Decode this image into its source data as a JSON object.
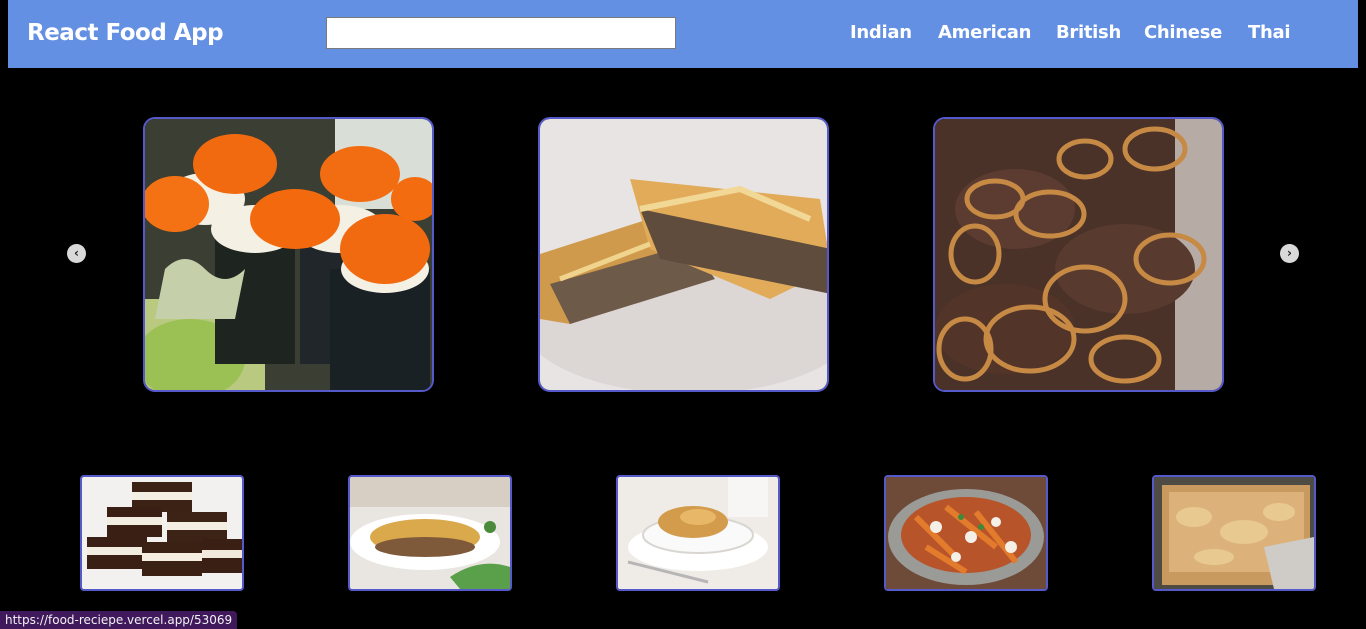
{
  "header": {
    "logo": "React Food App",
    "search": {
      "value": "",
      "placeholder": ""
    },
    "nav": [
      "Indian",
      "American",
      "British",
      "Chinese",
      "Thai"
    ]
  },
  "carousel": {
    "prev_icon": "chevron-left-icon",
    "next_icon": "chevron-right-icon",
    "slides": [
      {
        "image": "sushi-rolls-with-roe-photo"
      },
      {
        "image": "meat-pie-photo"
      },
      {
        "image": "beef-with-onions-photo"
      }
    ]
  },
  "thumbnails": [
    {
      "image": "layered-chocolate-bars-photo"
    },
    {
      "image": "lasagna-plate-photo"
    },
    {
      "image": "bread-pudding-bowl-photo"
    },
    {
      "image": "poutine-fries-photo"
    },
    {
      "image": "baked-casserole-photo"
    }
  ],
  "status_bar": {
    "url": "https://food-reciepe.vercel.app/53069"
  },
  "colors": {
    "navbar": "#6390e3",
    "card_border": "#5659c9",
    "background": "#000000"
  }
}
